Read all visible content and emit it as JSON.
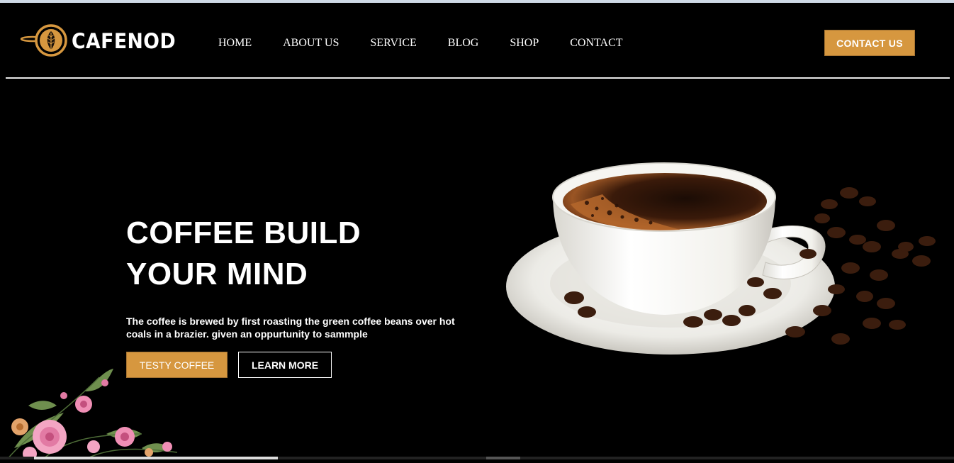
{
  "brand": {
    "name": "CAFENOD",
    "accent_color": "#d6973f"
  },
  "nav": {
    "items": [
      {
        "label": "HOME"
      },
      {
        "label": "ABOUT US"
      },
      {
        "label": "SERVICE"
      },
      {
        "label": "BLOG"
      },
      {
        "label": "SHOP"
      },
      {
        "label": "CONTACT"
      }
    ]
  },
  "header": {
    "cta_label": "CONTACT US"
  },
  "hero": {
    "title_line1": "COFFEE BUILD",
    "title_line2": "YOUR MIND",
    "description": "The coffee is brewed by first roasting the green coffee beans over hot coals in a brazier. given an oppurtunity to sammple",
    "primary_button": "TESTY COFFEE",
    "secondary_button": "LEARN MORE"
  },
  "icons": {
    "logo": "coffee-cup-leaf-icon",
    "hero_image": "coffee-cup-with-beans-image",
    "decoration": "pink-flowers-image"
  }
}
